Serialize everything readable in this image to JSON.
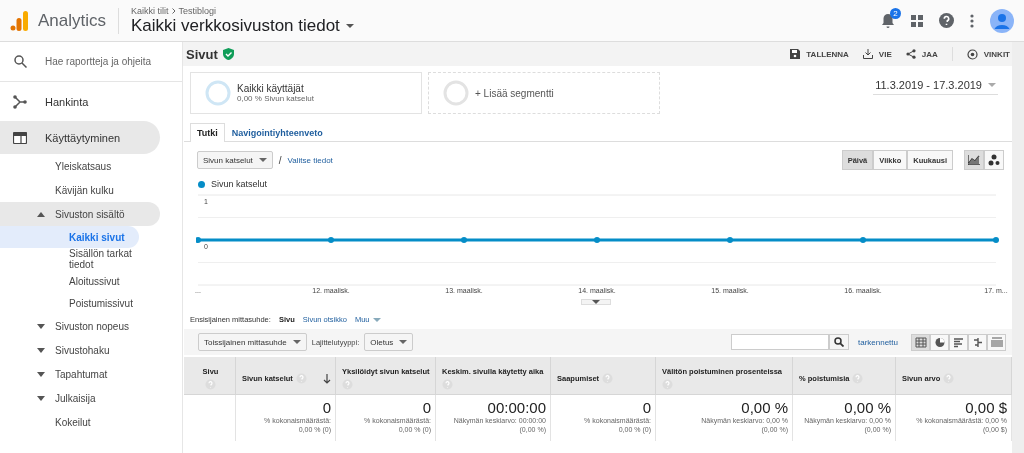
{
  "header": {
    "product": "Analytics",
    "breadcrumb": [
      "Kaikki tilit",
      "Testiblogi"
    ],
    "view": "Kaikki verkkosivuston tiedot",
    "notifications": "2"
  },
  "sidebar": {
    "search_placeholder": "Hae raportteja ja ohjeita",
    "items": [
      {
        "label": "Hankinta",
        "selected": false
      },
      {
        "label": "Käyttäytyminen",
        "selected": true,
        "children": [
          {
            "label": "Yleiskatsaus",
            "selected": false
          },
          {
            "label": "Kävijän kulku",
            "selected": false
          },
          {
            "label": "Sivuston sisältö",
            "selected": true,
            "expanded": true,
            "children": [
              {
                "label": "Kaikki sivut",
                "selected": true
              },
              {
                "label": "Sisällön tarkat tiedot",
                "selected": false
              },
              {
                "label": "Aloitussivut",
                "selected": false
              },
              {
                "label": "Poistumissivut",
                "selected": false
              }
            ]
          },
          {
            "label": "Sivuston nopeus",
            "selected": false,
            "expanded": false
          },
          {
            "label": "Sivustohaku",
            "selected": false,
            "expanded": false
          },
          {
            "label": "Tapahtumat",
            "selected": false,
            "expanded": false
          },
          {
            "label": "Julkaisija",
            "selected": false,
            "expanded": false
          },
          {
            "label": "Kokeilut",
            "selected": false
          }
        ]
      }
    ]
  },
  "report": {
    "title": "Sivut",
    "actions": [
      "TALLENNA",
      "VIE",
      "JAA",
      "VINKIT"
    ],
    "segments": [
      {
        "name": "Kaikki käyttäjät",
        "detail": "0,00 % Sivun katselut"
      }
    ],
    "add_segment": "+ Lisää segmentti",
    "date_range": "11.3.2019 - 17.3.2019",
    "tabs": [
      {
        "label": "Tutki",
        "selected": true
      },
      {
        "label": "Navigointiyhteenveto",
        "selected": false
      }
    ],
    "metric": "Sivun katselut",
    "separator": "/",
    "select_metric": "Valitse tiedot",
    "periods": [
      {
        "label": "Päivä",
        "selected": true
      },
      {
        "label": "Viikko",
        "selected": false
      },
      {
        "label": "Kuukausi",
        "selected": false
      }
    ],
    "chart_types": [
      {
        "kind": "line",
        "selected": true
      },
      {
        "kind": "motion",
        "selected": false
      }
    ],
    "chart_data": {
      "type": "line",
      "categories": [
        "...",
        "12. maalisk.",
        "13. maalisk.",
        "14. maalisk.",
        "15. maalisk.",
        "16. maalisk.",
        "17. m..."
      ],
      "series": [
        {
          "name": "Sivun katselut",
          "color": "#058dc7",
          "marker": "o",
          "values": [
            0,
            0,
            0,
            0,
            0,
            0,
            0
          ]
        }
      ],
      "ylim": [
        -1,
        1
      ],
      "yticks": [
        0,
        1
      ],
      "ref_lines": [
        {
          "axis": "y",
          "value": 0.5
        },
        {
          "axis": "y",
          "value": -0.5
        }
      ]
    },
    "primary_dimension": {
      "label": "Ensisijainen mittasuhde:",
      "options": [
        {
          "label": "Sivu",
          "selected": true
        },
        {
          "label": "Sivun otsikko",
          "selected": false
        },
        {
          "label": "Muu",
          "selected": false
        }
      ]
    },
    "secondary_dimension": "Toissijainen mittasuhde",
    "sort_label": "Lajittelutyyppi:",
    "sort_value": "Oletus",
    "advanced": "tarkennettu",
    "table_views": [
      {
        "kind": "table",
        "selected": true
      },
      {
        "kind": "pie",
        "selected": false
      },
      {
        "kind": "performance",
        "selected": false
      },
      {
        "kind": "comparison",
        "selected": false
      },
      {
        "kind": "pivot",
        "selected": false
      }
    ]
  },
  "table": {
    "columns": [
      {
        "label": "Sivu",
        "sorted": false
      },
      {
        "label": "Sivun katselut",
        "sorted": true
      },
      {
        "label": "Yksilöidyt sivun katselut",
        "sorted": false
      },
      {
        "label": "Keskim. sivulla käytetty aika",
        "sorted": false
      },
      {
        "label": "Saapumiset",
        "sorted": false
      },
      {
        "label": "Välitön poistuminen prosenteissa",
        "sorted": false
      },
      {
        "label": "% poistumisia",
        "sorted": false
      },
      {
        "label": "Sivun arvo",
        "sorted": false
      }
    ],
    "totals": [
      {
        "value": "0",
        "notes": [
          "% kokonaismäärästä:",
          "0,00 % (0)"
        ]
      },
      {
        "value": "0",
        "notes": [
          "% kokonaismäärästä:",
          "0,00 % (0)"
        ]
      },
      {
        "value": "00:00:00",
        "notes": [
          "Näkymän keskiarvo: 00:00:00",
          "(0,00 %)"
        ]
      },
      {
        "value": "0",
        "notes": [
          "% kokonaismäärästä:",
          "0,00 % (0)"
        ]
      },
      {
        "value": "0,00 %",
        "notes": [
          "Näkymän keskiarvo: 0,00 %",
          "(0,00 %)"
        ]
      },
      {
        "value": "0,00 %",
        "notes": [
          "Näkymän keskiarvo: 0,00 %",
          "(0,00 %)"
        ]
      },
      {
        "value": "0,00 $",
        "notes": [
          "% kokonaismäärästä: 0,00 %",
          "(0,00 $)"
        ]
      }
    ]
  }
}
